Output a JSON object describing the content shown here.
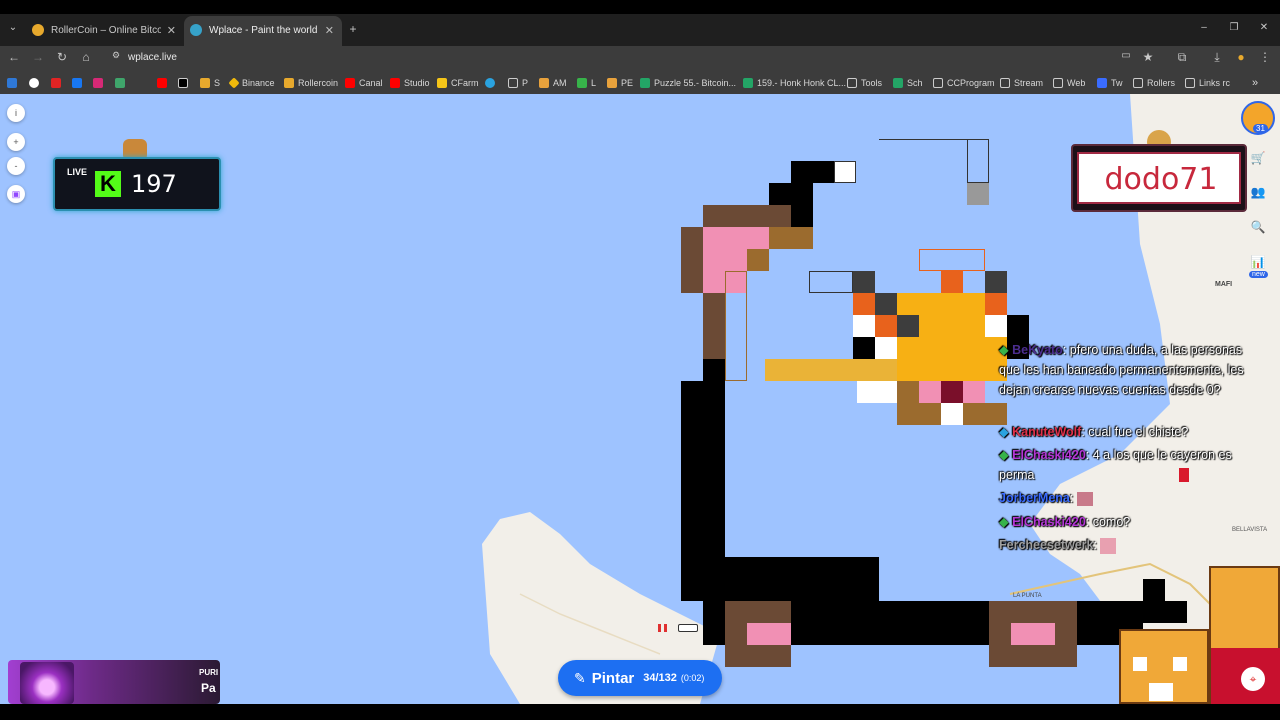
{
  "tabs": [
    {
      "title": "RollerCoin – Online Bitcoin Mining",
      "active": false,
      "favicon": "rollercoin-icon"
    },
    {
      "title": "Wplace - Paint the world",
      "active": true,
      "favicon": "wplace-globe-icon"
    }
  ],
  "toolbar": {
    "url": "wplace.live"
  },
  "bookmarks": [
    {
      "label": "S",
      "icon": "hamster-icon"
    },
    {
      "label": "Binance",
      "icon": "binance-icon"
    },
    {
      "label": "Rollercoin",
      "icon": "rollercoin-icon"
    },
    {
      "label": "Canal",
      "icon": "youtube-icon"
    },
    {
      "label": "Studio",
      "icon": "youtube-icon"
    },
    {
      "label": "CFarm",
      "icon": "cfarm-icon"
    },
    {
      "label": "P",
      "icon": "folder-icon"
    },
    {
      "label": "AM",
      "icon": "am-icon"
    },
    {
      "label": "L",
      "icon": "palm-icon"
    },
    {
      "label": "PE",
      "icon": "pe-icon"
    },
    {
      "label": "Puzzle 55.- Bitcoin...",
      "icon": "sheets-icon"
    },
    {
      "label": "159.- Honk Honk CL...",
      "icon": "sheets-icon"
    },
    {
      "label": "Tools",
      "icon": "folder-icon"
    },
    {
      "label": "Sch",
      "icon": "sheets-icon"
    },
    {
      "label": "CCProgram",
      "icon": "folder-icon"
    },
    {
      "label": "Stream",
      "icon": "folder-icon"
    },
    {
      "label": "Web",
      "icon": "folder-icon"
    },
    {
      "label": "Tw",
      "icon": "tw-icon"
    },
    {
      "label": "Rollers",
      "icon": "folder-icon"
    },
    {
      "label": "Links rc",
      "icon": "folder-icon"
    }
  ],
  "live_widget": {
    "label": "LIVE",
    "platform": "K",
    "viewer_count": "197"
  },
  "user_card": {
    "username": "dodo71"
  },
  "level_badge": "31",
  "stats_new_tag": "new",
  "map_labels": {
    "city": "MAFI",
    "district": "BELLAVISTA",
    "area": "LA PUNTA"
  },
  "chat": [
    {
      "user": "BeKyato",
      "text": ": pfero una duda, a las personas que les han baneado permanentemente, les dejan crearse nuevas cuentas desde 0?",
      "color": "#4b2d8f"
    },
    {
      "user": "KanuteWolf",
      "text": ": cual fue el chiste?",
      "color": "#e0314b"
    },
    {
      "user": "ElChaski420",
      "text": ": 4 a los que le cayeron es perma",
      "color": "#b436d6"
    },
    {
      "user": "JorberMena",
      "text": ":",
      "color": "#3a6cff"
    },
    {
      "user": "ElChaski420",
      "text": ": como?",
      "color": "#b436d6"
    },
    {
      "user": "Fercheesetwerk",
      "text": ":",
      "color": "#a0a0a0"
    }
  ],
  "paint_button": {
    "label": "Pintar",
    "count": "34/132",
    "timer": "(0:02)"
  },
  "music_widget": {
    "tag": "PURI",
    "title": "Pa"
  },
  "colors": {
    "map_water": "#9ec3ff",
    "accent_blue": "#1d6ff2",
    "kick_green": "#53fc18"
  }
}
